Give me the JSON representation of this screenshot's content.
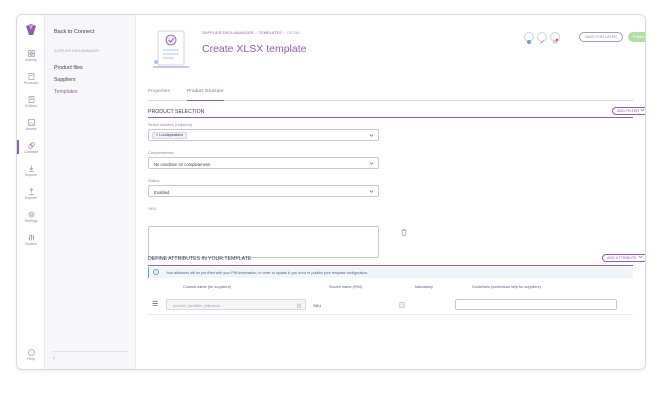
{
  "nav": {
    "items": [
      {
        "label": "Activity",
        "icon": "activity-icon"
      },
      {
        "label": "Products",
        "icon": "products-icon"
      },
      {
        "label": "Entities",
        "icon": "entities-icon"
      },
      {
        "label": "Assets",
        "icon": "assets-icon"
      },
      {
        "label": "Connect",
        "icon": "connect-icon",
        "active": true
      },
      {
        "label": "Imports",
        "icon": "imports-icon"
      },
      {
        "label": "Exports",
        "icon": "exports-icon"
      },
      {
        "label": "Settings",
        "icon": "settings-icon"
      },
      {
        "label": "System",
        "icon": "system-icon"
      }
    ],
    "help": "Help"
  },
  "panel": {
    "back": "Back to Connect",
    "section": "SUPPLIER DATA MANAGER",
    "links": [
      "Product files",
      "Suppliers",
      "Templates"
    ],
    "collapse": "‹"
  },
  "header": {
    "crumbs": [
      "SUPPLIER DATA MANAGER",
      "TEMPLATES",
      "DETAIL"
    ],
    "title": "Create XLSX template",
    "save_later": "SAVE FOR LATER",
    "publish": "Publish"
  },
  "tabs": [
    "Properties",
    "Product structure"
  ],
  "selection": {
    "title": "PRODUCT SELECTION",
    "add_filter": "ADD FILTER",
    "families_label": "Select families (required)",
    "family_chip": "× Loudspeakers",
    "completeness_label": "Completeness",
    "completeness_value": "No condition on completeness",
    "status_label": "Status",
    "status_value": "Enabled",
    "sku_label": "SKU"
  },
  "attributes": {
    "title": "DEFINE ATTRIBUTES IN YOUR TEMPLATE",
    "add_attribute": "ADD ATTRIBUTE",
    "info": "Your attributes will be pre-filled with your PIM information. In order to update it, you must re-publish your template configuration.",
    "columns": [
      "Column name (for suppliers)",
      "Source name (PIM)",
      "Mandatory",
      "Guidelines (contextual help for suppliers)"
    ],
    "rows": [
      {
        "column_name": "product_identifier_reference",
        "source": "SKU"
      }
    ]
  },
  "colors": {
    "accent": "#8f5ea8",
    "publish": "#b5dea3"
  }
}
